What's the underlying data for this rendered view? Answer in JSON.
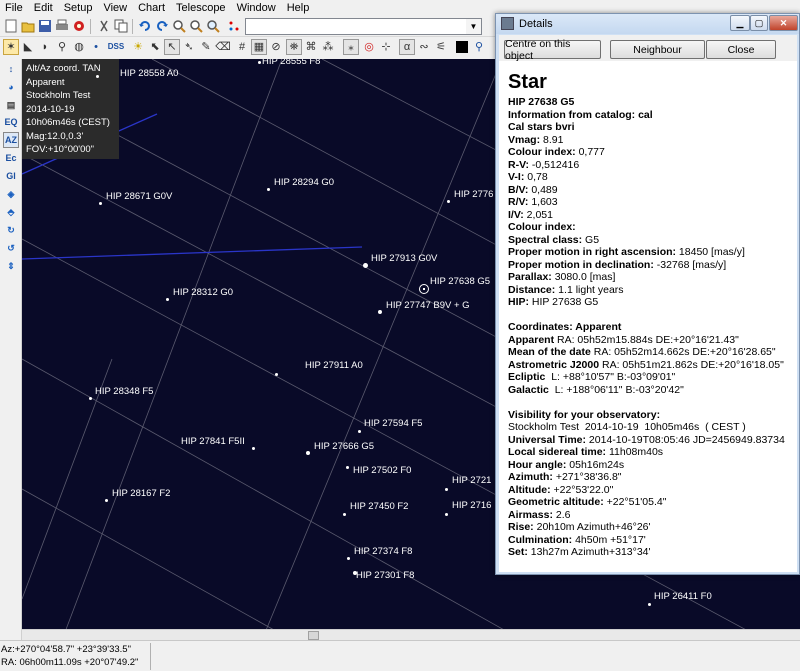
{
  "menu": [
    "File",
    "Edit",
    "Setup",
    "View",
    "Chart",
    "Telescope",
    "Window",
    "Help"
  ],
  "toolbar": {
    "dss_label": "DSS",
    "object_search_value": ""
  },
  "left_toolbar": [
    "EQ",
    "AZ",
    "Ec",
    "Gl"
  ],
  "info_box": [
    "Alt/Az coord. TAN",
    "Apparent",
    "Stockholm Test",
    "2014-10-19",
    "10h06m46s (CEST)",
    "Mag:12.0,0.3'",
    "FOV:+10°00'00\""
  ],
  "chart_data": {
    "type": "scatter",
    "title": "",
    "stars": [
      {
        "label": "HIP 28558 A0",
        "mag": 11.5
      },
      {
        "label": "HIP 28555 F8",
        "mag": 10.5
      },
      {
        "label": "HIP 28671 G0V",
        "mag": 10.0
      },
      {
        "label": "HIP 28294 G0",
        "mag": 10.0
      },
      {
        "label": "HIP 2776",
        "mag": 10.0
      },
      {
        "label": "HIP 27913 G0V",
        "mag": 8.5
      },
      {
        "label": "HIP 27638 G5",
        "mag": 8.9
      },
      {
        "label": "HIP 28312 G0",
        "mag": 10.0
      },
      {
        "label": "HIP 27747 B9V + G",
        "mag": 8.5
      },
      {
        "label": "HIP 27911 A0",
        "mag": 10.0
      },
      {
        "label": "HIP 28348 F5",
        "mag": 10.0
      },
      {
        "label": "HIP 27594 F5",
        "mag": 10.0
      },
      {
        "label": "HIP 27841 F5II",
        "mag": 10.0
      },
      {
        "label": "HIP 27666 G5",
        "mag": 9.5
      },
      {
        "label": "HIP 27502 F0",
        "mag": 10.0
      },
      {
        "label": "HIP 2721",
        "mag": 10.0
      },
      {
        "label": "HIP 28167 F2",
        "mag": 10.0
      },
      {
        "label": "HIP 27450 F2",
        "mag": 10.0
      },
      {
        "label": "HIP 2716",
        "mag": 10.0
      },
      {
        "label": "HIP 27374 F8",
        "mag": 10.0
      },
      {
        "label": "HIP 27301 F8",
        "mag": 9.5
      },
      {
        "label": "HIP 26411 F0",
        "mag": 10.0
      }
    ]
  },
  "status": {
    "altaz": "Az:+270°04'58.7\" +23°39'33.5\"",
    "radec": "RA: 06h00m11.09s +20°07'49.2\""
  },
  "details": {
    "title": "Details",
    "buttons": {
      "centre": "Centre on this object",
      "neighbour": "Neighbour",
      "close": "Close"
    },
    "heading": "Star",
    "lines": [
      {
        "b": "HIP 27638 G5",
        "t": ""
      },
      {
        "b": "Information from catalog: cal",
        "t": ""
      },
      {
        "b": "Cal stars bvri",
        "t": ""
      },
      {
        "b": "Vmag:",
        "t": " 8.91"
      },
      {
        "b": "Colour index:",
        "t": " 0,777"
      },
      {
        "b": "R-V:",
        "t": " -0,512416"
      },
      {
        "b": "V-I:",
        "t": " 0,78"
      },
      {
        "b": "B/V:",
        "t": " 0,489"
      },
      {
        "b": "R/V:",
        "t": " 1,603"
      },
      {
        "b": "I/V:",
        "t": " 2,051"
      },
      {
        "b": "Colour index:",
        "t": ""
      },
      {
        "b": "Spectral class:",
        "t": " G5"
      },
      {
        "b": "Proper motion in right ascension:",
        "t": " 18450 [mas/y]"
      },
      {
        "b": "Proper motion in declination:",
        "t": " -32768 [mas/y]"
      },
      {
        "b": "Parallax:",
        "t": " 3080.0 [mas]"
      },
      {
        "b": "Distance:",
        "t": " 1.1 light years"
      },
      {
        "b": "HIP:",
        "t": " HIP 27638 G5"
      },
      {
        "b": "",
        "t": ""
      },
      {
        "b": "Coordinates: Apparent",
        "t": ""
      },
      {
        "b": "Apparent",
        "t": " RA: 05h52m15.884s DE:+20°16'21.43\""
      },
      {
        "b": "Mean of the date",
        "t": " RA: 05h52m14.662s DE:+20°16'28.65\""
      },
      {
        "b": "Astrometric J2000",
        "t": " RA: 05h51m21.862s DE:+20°16'18.05\""
      },
      {
        "b": "Ecliptic",
        "t": "  L: +88°10'57\" B:-03°09'01\""
      },
      {
        "b": "Galactic",
        "t": "  L: +188°06'11\" B:-03°20'42\""
      },
      {
        "b": "",
        "t": ""
      },
      {
        "b": "Visibility for your observatory:",
        "t": ""
      },
      {
        "b": "",
        "t": "Stockholm Test  2014-10-19  10h05m46s  ( CEST )"
      },
      {
        "b": "Universal Time:",
        "t": " 2014-10-19T08:05:46 JD=2456949.83734"
      },
      {
        "b": "Local sidereal time:",
        "t": " 11h08m40s"
      },
      {
        "b": "Hour angle:",
        "t": " 05h16m24s"
      },
      {
        "b": "Azimuth:",
        "t": " +271°38'36.8\""
      },
      {
        "b": "Altitude:",
        "t": " +22°53'22.0\""
      },
      {
        "b": "Geometric altitude:",
        "t": " +22°51'05.4\""
      },
      {
        "b": "Airmass:",
        "t": " 2.6"
      },
      {
        "b": "Rise:",
        "t": " 20h10m Azimuth+46°26'"
      },
      {
        "b": "Culmination:",
        "t": " 4h50m +51°17'"
      },
      {
        "b": "Set:",
        "t": " 13h27m Azimuth+313°34'"
      }
    ]
  }
}
